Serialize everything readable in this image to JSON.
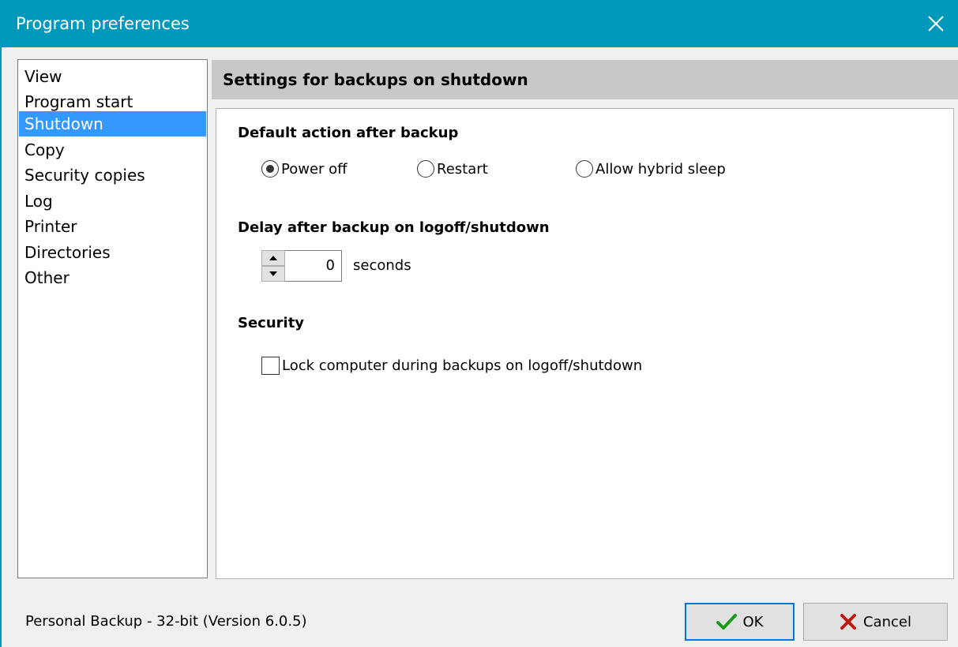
{
  "window": {
    "title": "Program preferences"
  },
  "nav": {
    "items": [
      {
        "label": "View"
      },
      {
        "label": "Program start"
      },
      {
        "label": "Shutdown"
      },
      {
        "label": "Copy"
      },
      {
        "label": "Security copies"
      },
      {
        "label": "Log"
      },
      {
        "label": "Printer"
      },
      {
        "label": "Directories"
      },
      {
        "label": "Other"
      }
    ],
    "selected": "Shutdown"
  },
  "panel": {
    "header": "Settings for backups on shutdown",
    "default_action": {
      "title": "Default action after backup",
      "options": [
        {
          "label": "Power off",
          "selected": true
        },
        {
          "label": "Restart",
          "selected": false
        },
        {
          "label": "Allow hybrid sleep",
          "selected": false
        }
      ]
    },
    "delay": {
      "title": "Delay after backup on logoff/shutdown",
      "value": "0",
      "unit": "seconds"
    },
    "security": {
      "title": "Security",
      "lock_label": "Lock computer during backups on logoff/shutdown",
      "lock_checked": false
    }
  },
  "footer": {
    "status": "Personal Backup - 32-bit (Version 6.0.5)",
    "ok_label": "OK",
    "cancel_label": "Cancel"
  },
  "colors": {
    "titlebar": "#0099bc",
    "selection": "#3399ff",
    "ok_check": "#1a9a1a",
    "cancel_x": "#c0180e"
  }
}
